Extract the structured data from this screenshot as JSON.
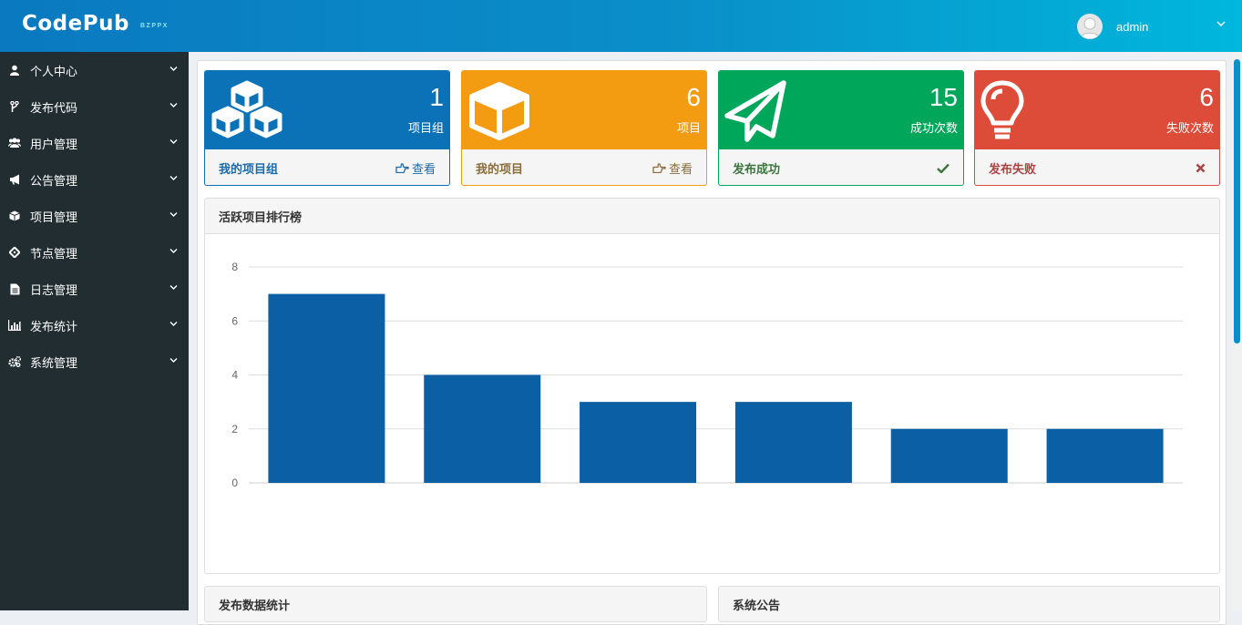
{
  "header": {
    "logo": "CodePub",
    "logo_sub": "BZPPX",
    "username": "admin"
  },
  "sidebar": {
    "items": [
      {
        "label": "个人中心",
        "icon": "user-icon"
      },
      {
        "label": "发布代码",
        "icon": "code-fork-icon"
      },
      {
        "label": "用户管理",
        "icon": "users-icon"
      },
      {
        "label": "公告管理",
        "icon": "bullhorn-icon"
      },
      {
        "label": "项目管理",
        "icon": "cube-icon"
      },
      {
        "label": "节点管理",
        "icon": "crosshairs-icon"
      },
      {
        "label": "日志管理",
        "icon": "file-text-icon"
      },
      {
        "label": "发布统计",
        "icon": "bar-chart-icon"
      },
      {
        "label": "系统管理",
        "icon": "cogs-icon"
      }
    ]
  },
  "stats": [
    {
      "num": "1",
      "label": "项目组",
      "footer": "我的项目组",
      "action": "查看",
      "color": "#0b72b8",
      "icon": "cubes-icon"
    },
    {
      "num": "6",
      "label": "项目",
      "footer": "我的项目",
      "action": "查看",
      "color": "#f39c12",
      "icon": "cube-icon"
    },
    {
      "num": "15",
      "label": "成功次数",
      "footer": "发布成功",
      "color": "#00a65a",
      "icon": "paper-plane-icon"
    },
    {
      "num": "6",
      "label": "失败次数",
      "footer": "发布失败",
      "color": "#dd4b39",
      "icon": "lightbulb-icon"
    }
  ],
  "chart_card": {
    "title": "活跃项目排行榜"
  },
  "chart_data": {
    "type": "bar",
    "categories": [
      "",
      "",
      "",
      "",
      "",
      ""
    ],
    "values": [
      7,
      4,
      3,
      3,
      2,
      2
    ],
    "ylim": [
      0,
      8
    ],
    "yticks": [
      "0",
      "2",
      "4",
      "6",
      "8"
    ],
    "grid": true,
    "bar_color": "#0b5fa5"
  },
  "bottom_cards": {
    "left_title": "发布数据统计",
    "right_title": "系统公告"
  }
}
